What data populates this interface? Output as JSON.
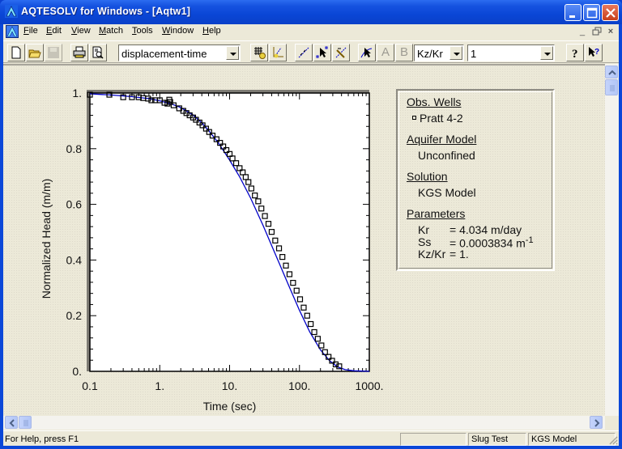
{
  "window": {
    "title": "AQTESOLV for Windows - [Aqtw1]"
  },
  "menu": {
    "items": [
      {
        "label": "File",
        "accel": "F"
      },
      {
        "label": "Edit",
        "accel": "E"
      },
      {
        "label": "View",
        "accel": "V"
      },
      {
        "label": "Match",
        "accel": "M"
      },
      {
        "label": "Tools",
        "accel": "T"
      },
      {
        "label": "Window",
        "accel": "W"
      },
      {
        "label": "Help",
        "accel": "H"
      }
    ]
  },
  "toolbar": {
    "plot_type_value": "displacement-time",
    "param_select_value": "Kz/Kr",
    "param_value": "1",
    "disabled_letters": [
      "A",
      "B"
    ],
    "icons": [
      "new-file-icon",
      "open-folder-icon",
      "save-icon",
      "print-icon",
      "print-preview-icon",
      "grid-icon",
      "match-icon",
      "line-fit-icon",
      "pointer-match-icon",
      "pointer-line-icon",
      "pointer-curve-icon",
      "help-icon",
      "context-help-icon"
    ]
  },
  "legend": {
    "obs_wells_heading": "Obs. Wells",
    "obs_well": "Pratt 4-2",
    "aquifer_model_heading": "Aquifer Model",
    "aquifer_model": "Unconfined",
    "solution_heading": "Solution",
    "solution": "KGS Model",
    "parameters_heading": "Parameters",
    "parameters": [
      {
        "name": "Kr",
        "value": "= 4.034 m/day",
        "sup": ""
      },
      {
        "name": "Ss",
        "value": "= 0.0003834 m",
        "sup": "-1"
      },
      {
        "name": "Kz/Kr",
        "value": "= 1.",
        "sup": ""
      }
    ]
  },
  "status": {
    "help_text": "For Help, press F1",
    "pane1": "",
    "pane2": "Slug Test",
    "pane3": "KGS Model"
  },
  "chart_data": {
    "type": "scatter",
    "title": "",
    "xlabel": "Time (sec)",
    "ylabel": "Normalized Head (m/m)",
    "x_scale": "log",
    "xlim": [
      0.1,
      1000
    ],
    "ylim": [
      0,
      1
    ],
    "x_ticks": [
      0.1,
      1,
      10,
      100,
      1000
    ],
    "x_tick_labels": [
      "0.1",
      "1.",
      "10.",
      "100.",
      "1000."
    ],
    "y_ticks": [
      0,
      0.2,
      0.4,
      0.6,
      0.8,
      1
    ],
    "y_tick_labels": [
      "0.",
      "0.2",
      "0.4",
      "0.6",
      "0.8",
      "1."
    ],
    "grid": false,
    "series": [
      {
        "name": "Pratt 4-2",
        "kind": "observed",
        "marker": "square",
        "color": "#000000",
        "x": [
          0.1,
          0.19,
          0.3,
          0.4,
          0.5,
          0.58,
          0.68,
          0.76,
          0.86,
          1.0,
          1.17,
          1.29,
          1.37,
          1.41,
          1.58,
          1.9,
          2.17,
          2.41,
          2.68,
          3.0,
          3.3,
          3.7,
          4.1,
          4.6,
          5.1,
          5.7,
          6.5,
          7.3,
          8.1,
          9.0,
          10.0,
          11.0,
          12.4,
          13.9,
          15.4,
          17.0,
          18.6,
          20.5,
          23.0,
          25.7,
          28.5,
          32.0,
          36.0,
          40.0,
          45.0,
          51.0,
          57.0,
          64.0,
          72.0,
          81.0,
          91.0,
          102.0,
          115.0,
          129.0,
          145.0,
          163.0,
          183.0,
          206.0,
          232.0,
          261.0,
          293.0,
          330.0,
          371.0
        ],
        "y": [
          0.994,
          0.994,
          0.985,
          0.985,
          0.985,
          0.982,
          0.98,
          0.974,
          0.974,
          0.974,
          0.965,
          0.962,
          0.976,
          0.968,
          0.956,
          0.945,
          0.936,
          0.928,
          0.92,
          0.912,
          0.904,
          0.894,
          0.884,
          0.872,
          0.86,
          0.847,
          0.834,
          0.821,
          0.808,
          0.795,
          0.781,
          0.765,
          0.748,
          0.73,
          0.715,
          0.698,
          0.68,
          0.657,
          0.632,
          0.611,
          0.585,
          0.558,
          0.53,
          0.501,
          0.47,
          0.442,
          0.411,
          0.38,
          0.349,
          0.318,
          0.29,
          0.259,
          0.229,
          0.2,
          0.17,
          0.141,
          0.117,
          0.093,
          0.069,
          0.052,
          0.038,
          0.025,
          0.018
        ]
      },
      {
        "name": "KGS Model fit",
        "kind": "curve",
        "color": "#0000c8",
        "x": [
          0.1,
          0.2,
          0.4,
          0.7,
          1.0,
          1.5,
          2.0,
          3.0,
          4.0,
          5.0,
          7.0,
          10.0,
          14.0,
          20.0,
          30.0,
          40.0,
          50.0,
          70.0,
          100.0,
          140.0,
          200.0,
          270.0,
          350.0,
          450.0,
          600.0,
          1000.0
        ],
        "y": [
          0.997,
          0.993,
          0.987,
          0.98,
          0.972,
          0.96,
          0.948,
          0.921,
          0.893,
          0.866,
          0.819,
          0.759,
          0.698,
          0.622,
          0.525,
          0.452,
          0.395,
          0.309,
          0.219,
          0.142,
          0.077,
          0.038,
          0.016,
          0.006,
          0.002,
          0.0
        ]
      }
    ]
  }
}
